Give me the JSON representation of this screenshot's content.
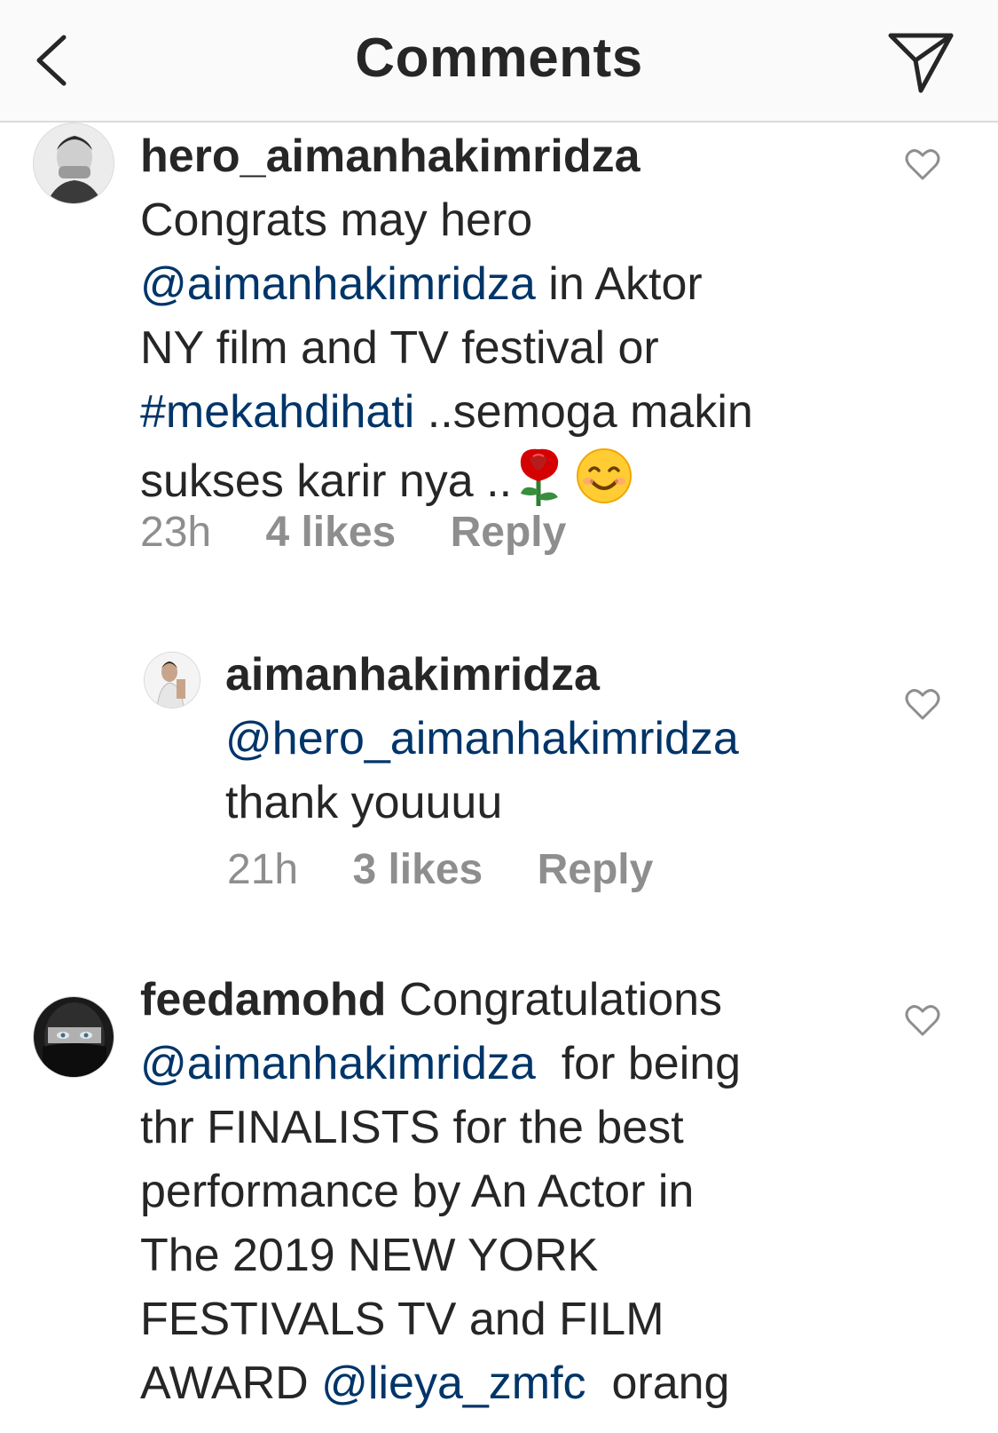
{
  "header": {
    "title": "Comments",
    "back_icon": "chevron-left-icon",
    "send_icon": "paper-plane-icon"
  },
  "colors": {
    "mention": "#003569",
    "text": "#262626",
    "meta": "#8e8e8e",
    "header_bg": "#fafafa"
  },
  "comments": [
    {
      "username": "hero_aimanhakimridza",
      "lines": [
        {
          "text": "Congrats may hero"
        },
        {
          "mention": "@aimanhakimridza",
          "text": " in Aktor"
        },
        {
          "text": "NY film and TV festival or"
        },
        {
          "mention": "#mekahdihati",
          "text": " ..semoga makin"
        },
        {
          "text": "sukses karir nya .."
        }
      ],
      "time": "23h",
      "likes": "4 likes",
      "reply": "Reply"
    },
    {
      "username": "aimanhakimridza",
      "lines": [
        {
          "mention": "@hero_aimanhakimridza"
        },
        {
          "text": "thank youuuu"
        }
      ],
      "time": "21h",
      "likes": "3 likes",
      "reply": "Reply"
    },
    {
      "username": "feedamohd",
      "lines": [
        {
          "text": " Congratulations"
        },
        {
          "mention": "@aimanhakimridza",
          "text": "  for being"
        },
        {
          "text": "thr FINALISTS for the best"
        },
        {
          "text": "performance by An Actor in"
        },
        {
          "text": "The 2019 NEW YORK"
        },
        {
          "text": "FESTIVALS TV and FILM"
        },
        {
          "text": "AWARD ",
          "mention": "@lieya_zmfc",
          "text2": "  orang"
        }
      ]
    }
  ]
}
